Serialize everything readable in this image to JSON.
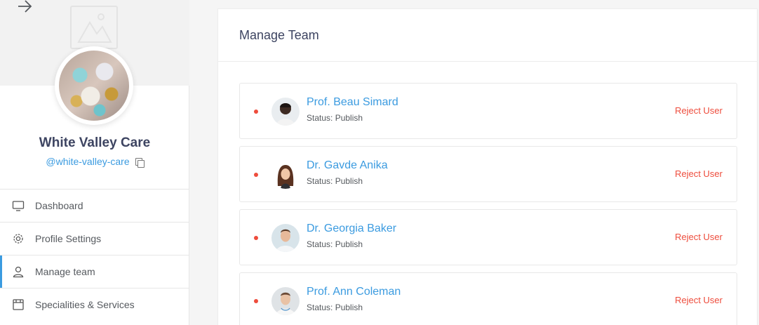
{
  "profile": {
    "name": "White Valley Care",
    "handle": "@white-valley-care"
  },
  "nav": [
    {
      "label": "Dashboard",
      "icon": "monitor-icon"
    },
    {
      "label": "Profile Settings",
      "icon": "gear-icon"
    },
    {
      "label": "Manage team",
      "icon": "user-icon",
      "active": true
    },
    {
      "label": "Specialities & Services",
      "icon": "calendar-icon"
    }
  ],
  "card": {
    "title": "Manage Team"
  },
  "team": [
    {
      "name": "Prof. Beau Simard",
      "status": "Status: Publish",
      "action": "Reject User"
    },
    {
      "name": "Dr. Gavde Anika",
      "status": "Status: Publish",
      "action": "Reject User"
    },
    {
      "name": "Dr. Georgia Baker",
      "status": "Status: Publish",
      "action": "Reject User"
    },
    {
      "name": "Prof. Ann Coleman",
      "status": "Status: Publish",
      "action": "Reject User"
    }
  ],
  "colors": {
    "accent": "#3b9be0",
    "danger": "#ee4c3c",
    "heading": "#3d4461"
  }
}
